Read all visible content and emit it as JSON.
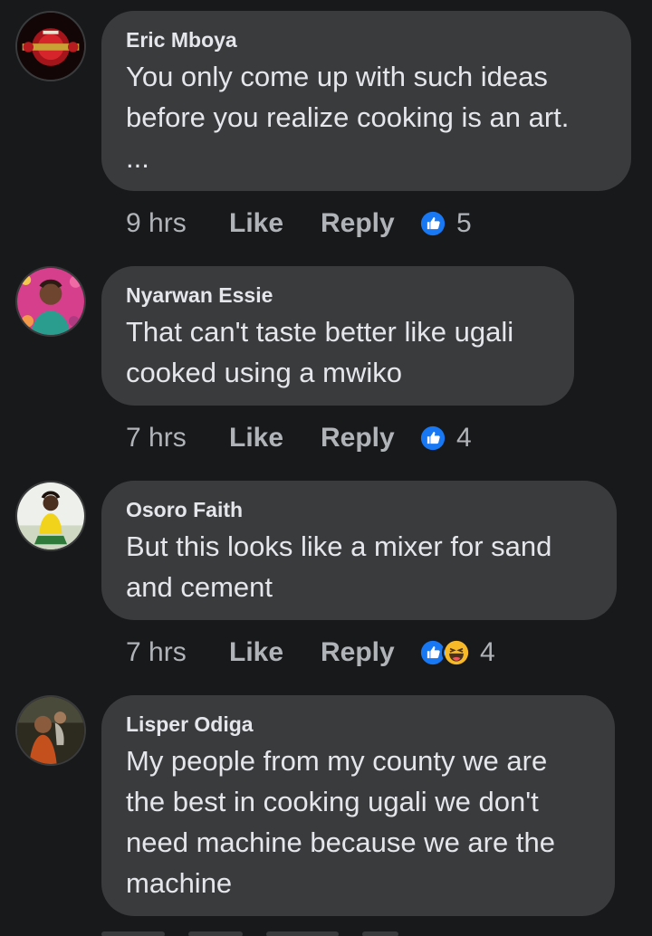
{
  "comments": [
    {
      "author": "Eric Mboya",
      "text": "You only come up with such ideas before you realize cooking is an art.",
      "more": "...",
      "time": "9 hrs",
      "like_label": "Like",
      "reply_label": "Reply",
      "reactions": [
        "like-icon"
      ],
      "reaction_count": "5"
    },
    {
      "author": "Nyarwan Essie",
      "text": "That can't taste better like ugali cooked using a mwiko",
      "time": "7 hrs",
      "like_label": "Like",
      "reply_label": "Reply",
      "reactions": [
        "like-icon"
      ],
      "reaction_count": "4"
    },
    {
      "author": "Osoro Faith",
      "text": "But this looks like a mixer for sand and cement",
      "time": "7 hrs",
      "like_label": "Like",
      "reply_label": "Reply",
      "reactions": [
        "like-icon",
        "haha-icon"
      ],
      "reaction_count": "4"
    },
    {
      "author": "Lisper Odiga",
      "text": "My people from my county we are the best in cooking ugali we don't need machine because we are the machine"
    }
  ],
  "colors": {
    "background": "#18191a",
    "bubble": "#3a3b3c",
    "primary_text": "#e4e6eb",
    "secondary_text": "#b0b3b8",
    "like_blue": "#1877f2",
    "haha_yellow": "#f7b928"
  }
}
